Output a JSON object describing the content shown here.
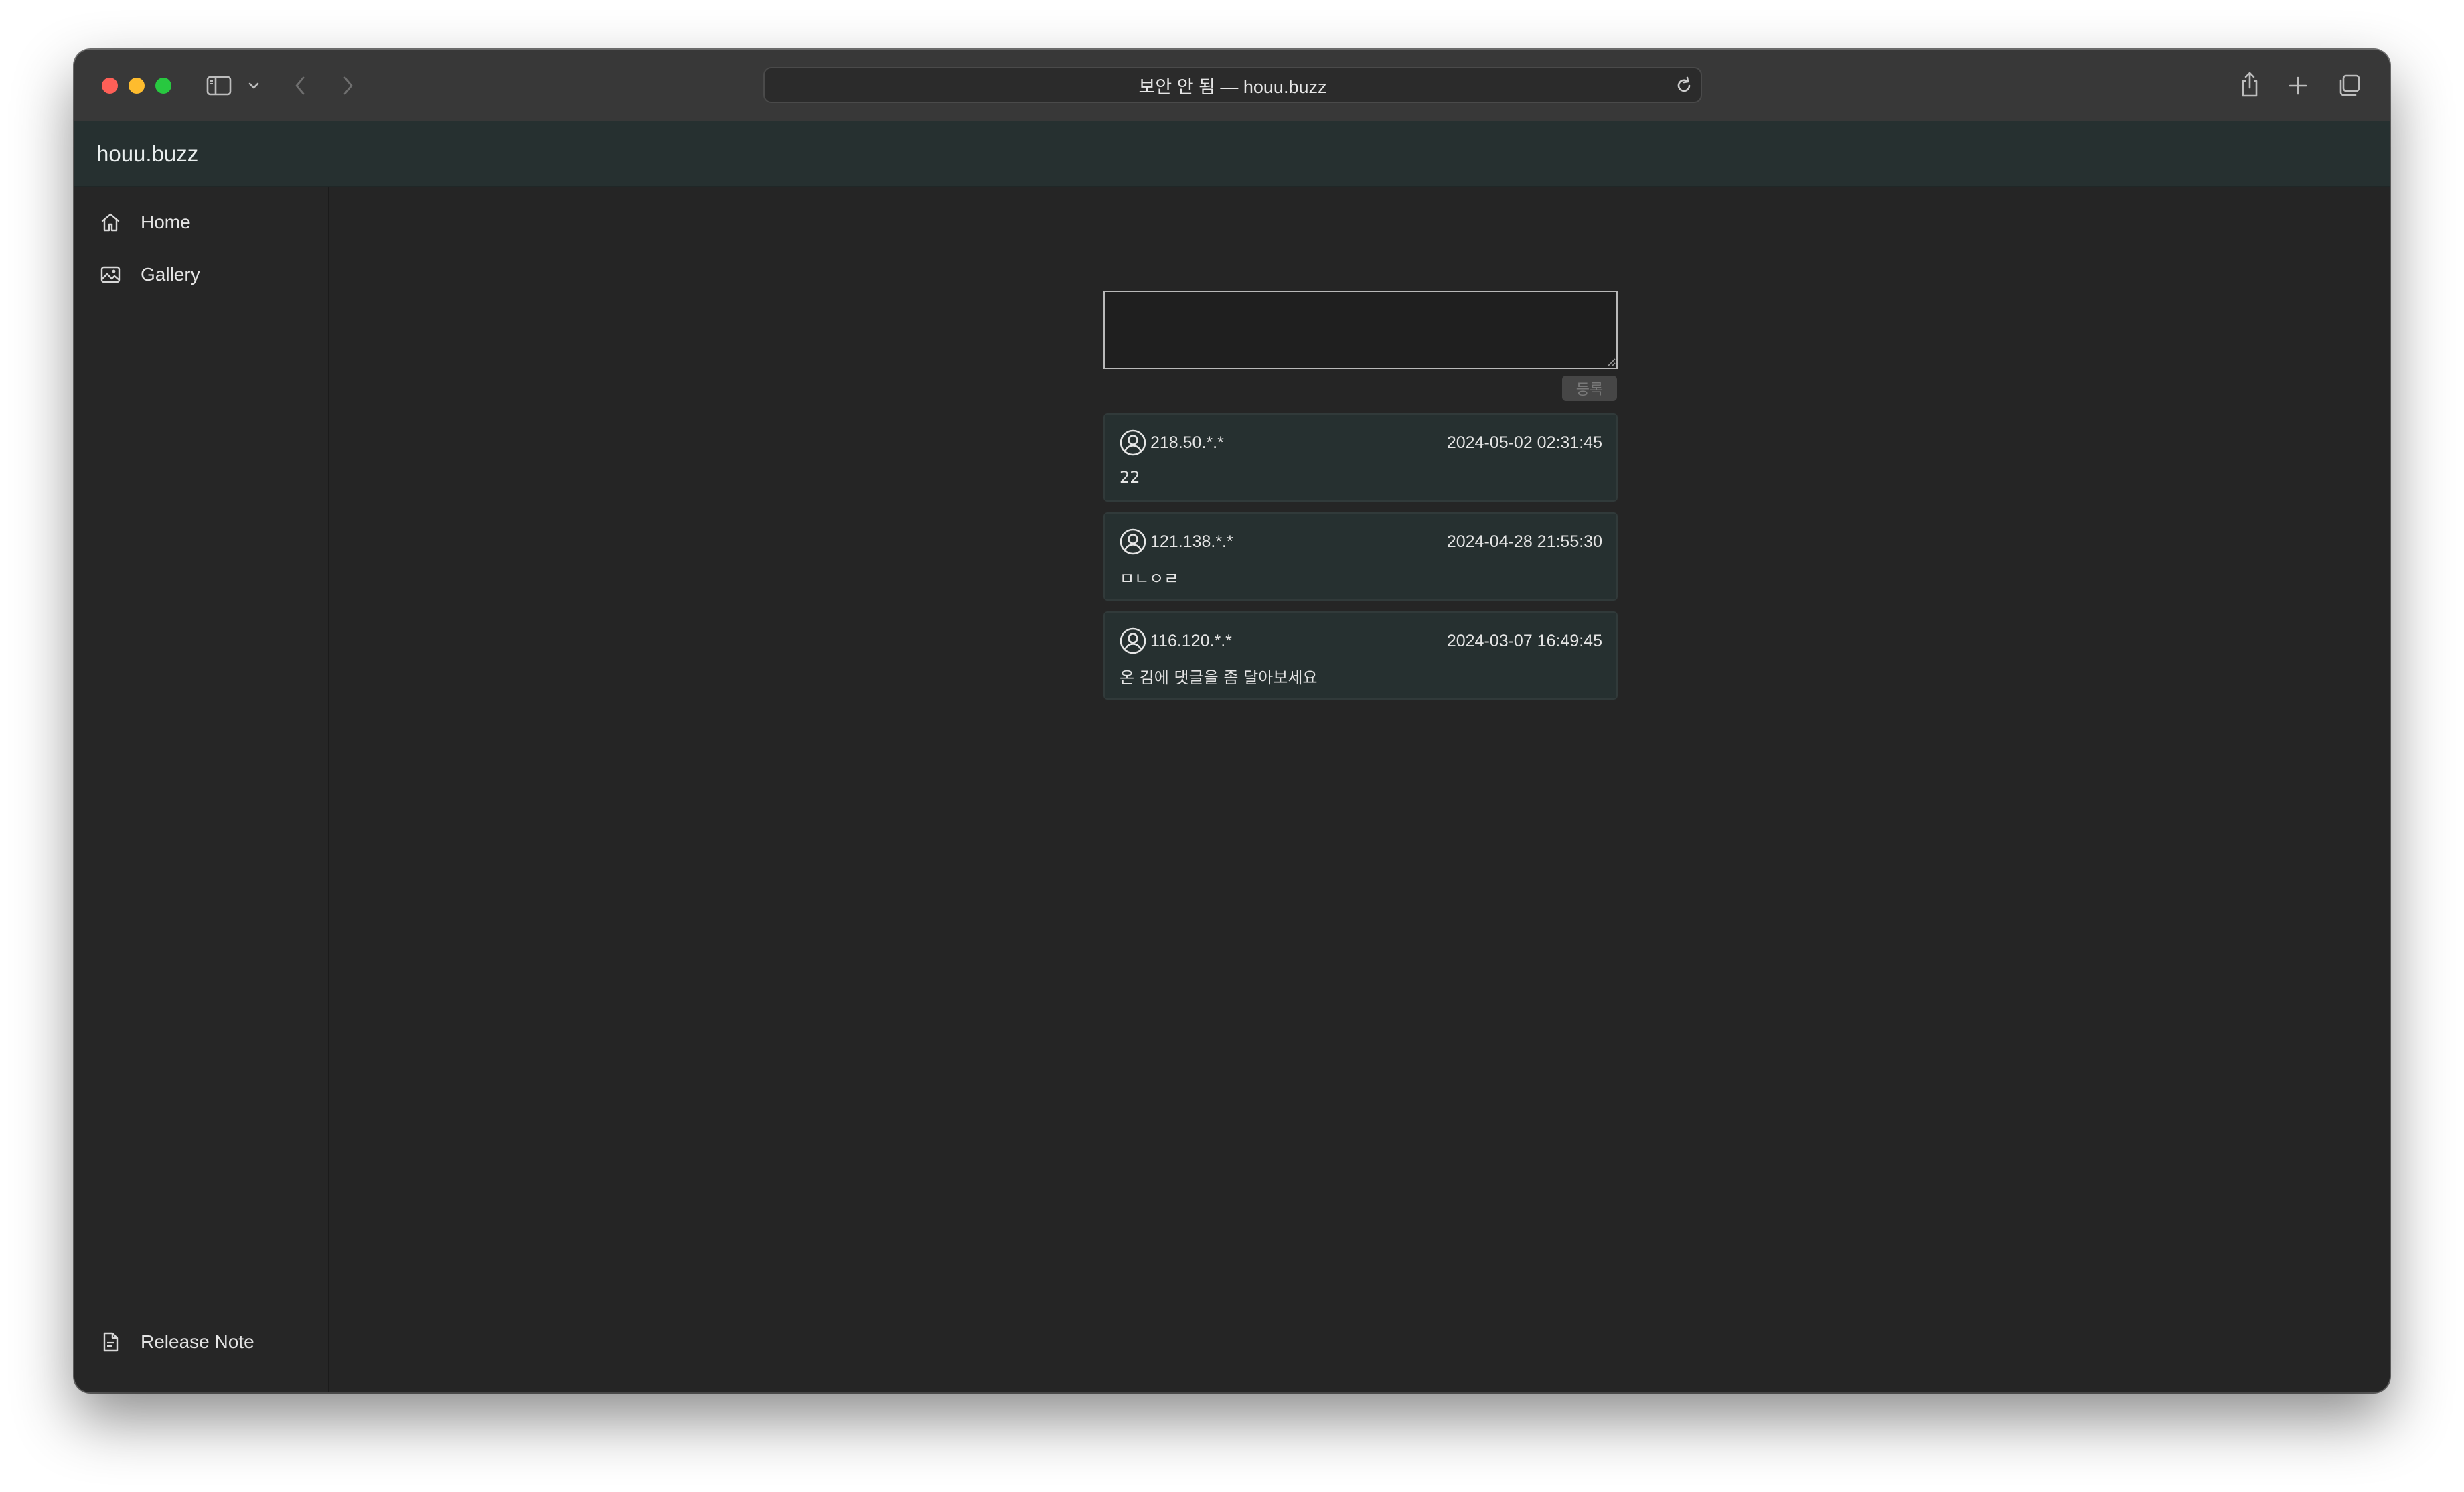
{
  "browser": {
    "url_display": "보안 안 됨 — houu.buzz",
    "icons": [
      "sidebar-toggle-icon",
      "chevron-down-icon",
      "back-icon",
      "forward-icon",
      "reload-icon",
      "share-icon",
      "new-tab-icon",
      "tab-overview-icon"
    ]
  },
  "site": {
    "title": "houu.buzz"
  },
  "sidebar": {
    "items": [
      {
        "label": "Home",
        "icon": "home-icon"
      },
      {
        "label": "Gallery",
        "icon": "image-icon"
      }
    ],
    "footer": {
      "label": "Release Note",
      "icon": "document-icon"
    }
  },
  "compose": {
    "value": "",
    "submit_label": "등록"
  },
  "comments": [
    {
      "ip": "218.50.*.*",
      "date": "2024-05-02 02:31:45",
      "text": "22"
    },
    {
      "ip": "121.138.*.*",
      "date": "2024-04-28 21:55:30",
      "text": "ㅁㄴㅇㄹ"
    },
    {
      "ip": "116.120.*.*",
      "date": "2024-03-07 16:49:45",
      "text": "온 김에 댓글을 좀 달아보세요"
    }
  ],
  "colors": {
    "header_bg": "#263030",
    "comment_bg": "#263030",
    "page_bg": "#252525",
    "sidebar_bg": "#262626"
  }
}
